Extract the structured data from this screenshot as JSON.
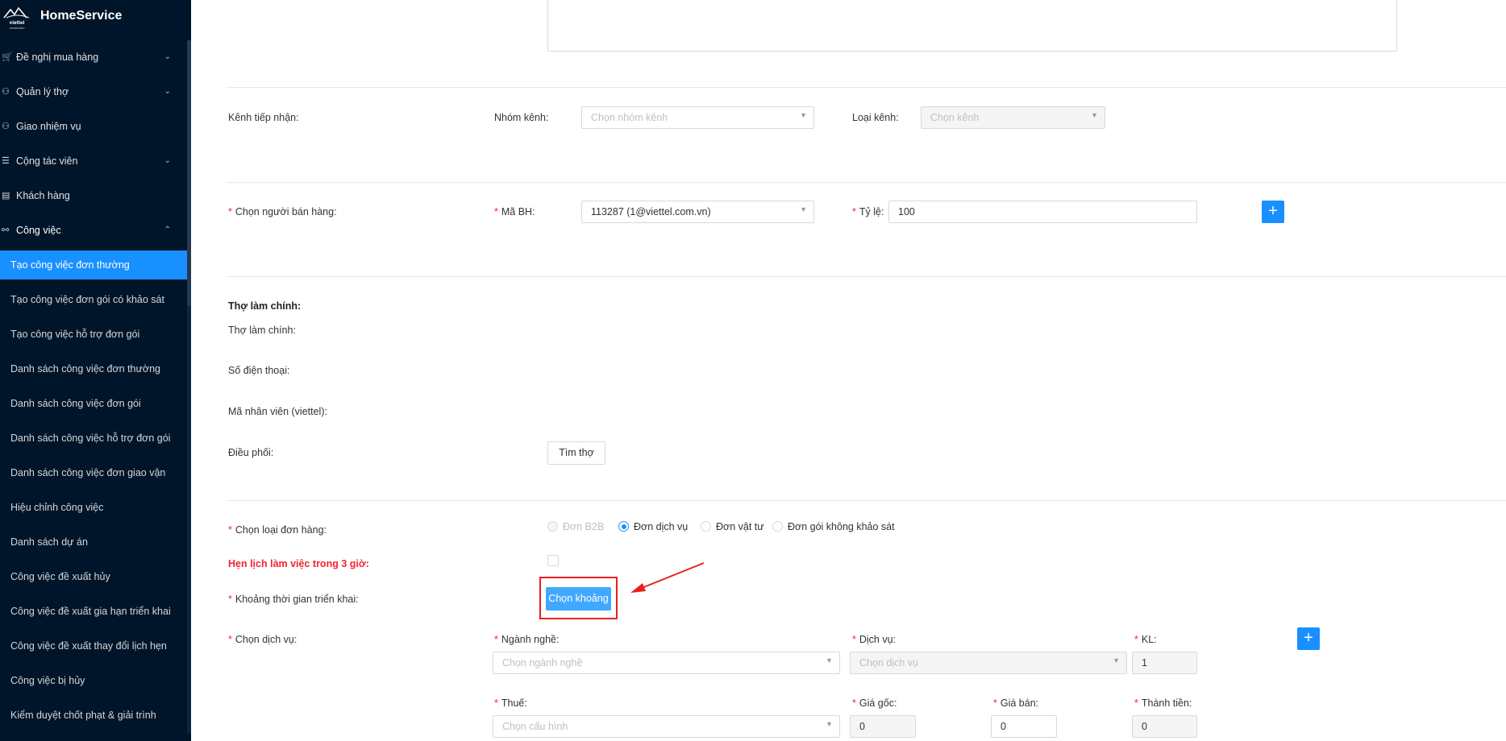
{
  "app": {
    "title": "HomeService",
    "logo_text": "viettel construction"
  },
  "sidebar": {
    "menu": [
      {
        "label": "Đề nghị mua hàng",
        "icon": "cart-icon",
        "glyph": "🛒",
        "chevron": "⌄"
      },
      {
        "label": "Quản lý thợ",
        "icon": "worker-icon",
        "glyph": "⚇",
        "chevron": "⌄"
      },
      {
        "label": "Giao nhiệm vụ",
        "icon": "assign-icon",
        "glyph": "⚇",
        "chevron": ""
      },
      {
        "label": "Cộng tác viên",
        "icon": "list-icon",
        "glyph": "☰",
        "chevron": "⌄"
      },
      {
        "label": "Khách hàng",
        "icon": "customer-icon",
        "glyph": "▤",
        "chevron": ""
      },
      {
        "label": "Công việc",
        "icon": "workflow-icon",
        "glyph": "⚯",
        "chevron": "⌃"
      }
    ],
    "submenu": [
      "Tạo công việc đơn thường",
      "Tạo công việc đơn gói có khảo sát",
      "Tạo công việc hỗ trợ đơn gói",
      "Danh sách công việc đơn thường",
      "Danh sách công việc đơn gói",
      "Danh sách công việc hỗ trợ đơn gói",
      "Danh sách công việc đơn giao vận",
      "Hiệu chỉnh công việc",
      "Danh sách dự án",
      "Công việc đề xuất hủy",
      "Công việc đề xuất gia hạn triển khai",
      "Công việc đề xuất thay đổi lịch hẹn",
      "Công việc bị hủy",
      "Kiểm duyệt chốt phạt & giải trình"
    ],
    "active_index": 0
  },
  "form": {
    "channel": {
      "label": "Kênh tiếp nhận:",
      "group_label": "Nhóm kênh:",
      "group_placeholder": "Chọn nhóm kênh",
      "type_label": "Loại kênh:",
      "type_placeholder": "Chọn kênh"
    },
    "seller": {
      "label": "Chọn người bán hàng:",
      "code_label": "Mã BH:",
      "code_value": "113287 (1@viettel.com.vn)",
      "ratio_label": "Tỷ lệ:",
      "ratio_value": "100",
      "add_glyph": "+"
    },
    "worker": {
      "heading": "Thợ làm chính:",
      "main_label": "Thợ làm chính:",
      "phone_label": "Số điện thoại:",
      "staff_label": "Mã nhân viên (viettel):",
      "dispatch_label": "Điều phối:",
      "find_button": "Tìm thợ"
    },
    "order_type": {
      "label": "Chọn loại đơn hàng:",
      "options": [
        "Đơn B2B",
        "Đơn dịch vụ",
        "Đơn vật tư",
        "Đơn gói không khảo sát"
      ],
      "selected": "Đơn dịch vụ"
    },
    "schedule": {
      "label": "Hẹn lịch làm việc trong 3 giờ:",
      "checked": false
    },
    "period": {
      "label": "Khoảng thời gian triển khai:",
      "button": "Chọn khoảng"
    },
    "service": {
      "label": "Chọn dịch vụ:",
      "industry_label": "Ngành nghề:",
      "industry_placeholder": "Chọn ngành nghề",
      "service_label": "Dịch vụ:",
      "service_placeholder": "Chọn dịch vụ",
      "qty_label": "KL:",
      "qty_value": "1",
      "tax_label": "Thuế:",
      "tax_placeholder": "Chọn cấu hình",
      "base_price_label": "Giá gốc:",
      "base_price_value": "0",
      "sale_price_label": "Giá bán:",
      "sale_price_value": "0",
      "total_label": "Thành tiền:",
      "total_value": "0",
      "add_glyph": "+"
    }
  },
  "colors": {
    "sidebar_bg": "#001529",
    "primary": "#1890ff",
    "required": "#f5222d",
    "highlight": "#e8201f",
    "button_blue": "#40a9ff"
  }
}
